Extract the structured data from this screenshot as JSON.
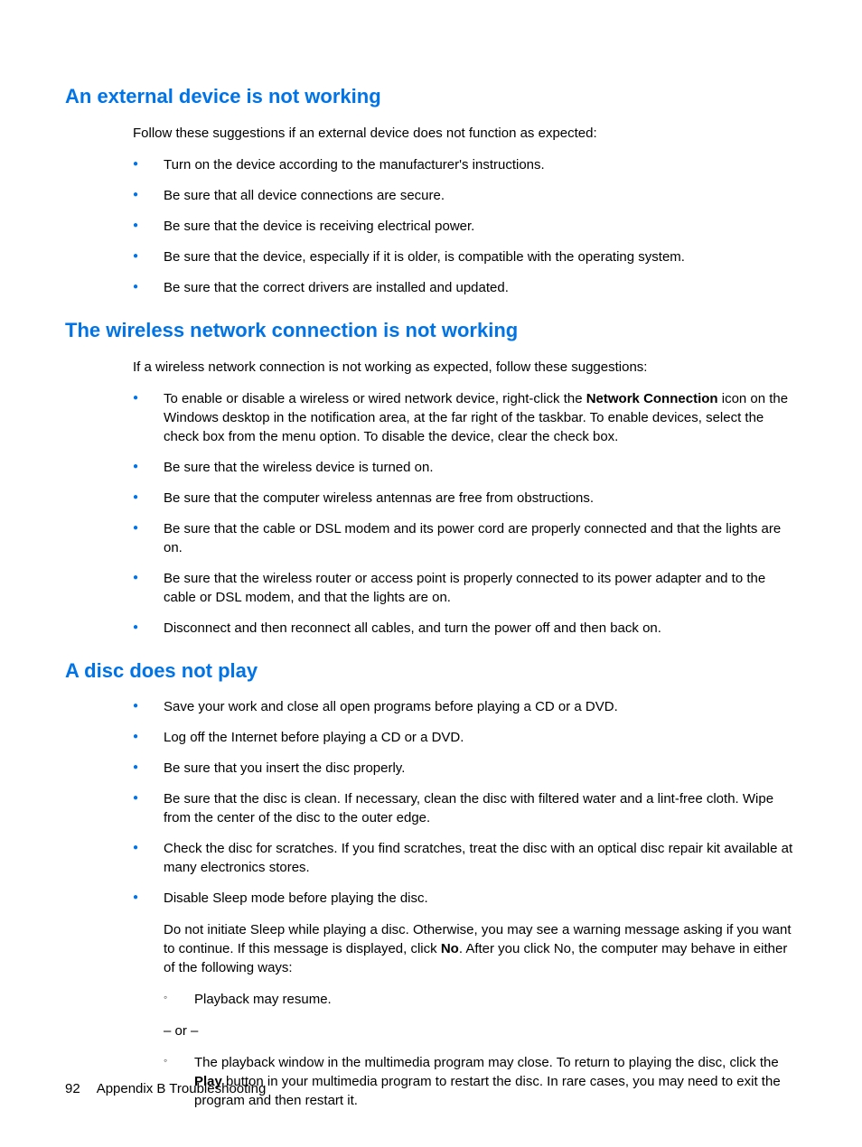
{
  "section1": {
    "heading": "An external device is not working",
    "intro": "Follow these suggestions if an external device does not function as expected:",
    "items": [
      "Turn on the device according to the manufacturer's instructions.",
      "Be sure that all device connections are secure.",
      "Be sure that the device is receiving electrical power.",
      "Be sure that the device, especially if it is older, is compatible with the operating system.",
      "Be sure that the correct drivers are installed and updated."
    ]
  },
  "section2": {
    "heading": "The wireless network connection is not working",
    "intro": "If a wireless network connection is not working as expected, follow these suggestions:",
    "item0_pre": "To enable or disable a wireless or wired network device, right-click the ",
    "item0_bold": "Network Connection",
    "item0_post": " icon on the Windows desktop in the notification area, at the far right of the taskbar. To enable devices, select the check box from the menu option. To disable the device, clear the check box.",
    "items_rest": [
      "Be sure that the wireless device is turned on.",
      "Be sure that the computer wireless antennas are free from obstructions.",
      "Be sure that the cable or DSL modem and its power cord are properly connected and that the lights are on.",
      "Be sure that the wireless router or access point is properly connected to its power adapter and to the cable or DSL modem, and that the lights are on.",
      "Disconnect and then reconnect all cables, and turn the power off and then back on."
    ]
  },
  "section3": {
    "heading": "A disc does not play",
    "items_simple": [
      "Save your work and close all open programs before playing a CD or a DVD.",
      "Log off the Internet before playing a CD or a DVD.",
      "Be sure that you insert the disc properly.",
      "Be sure that the disc is clean. If necessary, clean the disc with filtered water and a lint-free cloth. Wipe from the center of the disc to the outer edge.",
      "Check the disc for scratches. If you find scratches, treat the disc with an optical disc repair kit available at many electronics stores."
    ],
    "item_last_line1": "Disable Sleep mode before playing the disc.",
    "item_last_para_pre": "Do not initiate Sleep while playing a disc. Otherwise, you may see a warning message asking if you want to continue. If this message is displayed, click ",
    "item_last_para_bold": "No",
    "item_last_para_post": ". After you click No, the computer may behave in either of the following ways:",
    "sub1": "Playback may resume.",
    "or": "– or –",
    "sub2_pre": "The playback window in the multimedia program may close. To return to playing the disc, click the ",
    "sub2_bold": "Play",
    "sub2_post": " button in your multimedia program to restart the disc. In rare cases, you may need to exit the program and then restart it."
  },
  "footer": {
    "page": "92",
    "appendix": "Appendix B   Troubleshooting"
  }
}
